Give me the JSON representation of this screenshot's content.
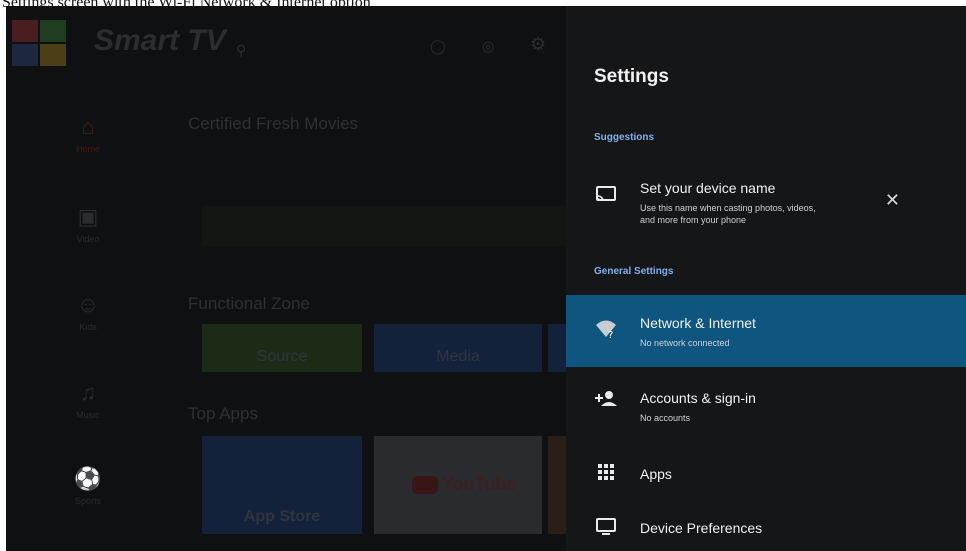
{
  "caption": "Settings screen with the Wi-Fi Network & Internet option",
  "home": {
    "brand": "Smart TV",
    "nav": [
      {
        "icon": "home-icon",
        "label": "Home"
      },
      {
        "icon": "video-icon",
        "label": "Video"
      },
      {
        "icon": "kids-icon",
        "label": "Kids"
      },
      {
        "icon": "music-icon",
        "label": "Music"
      },
      {
        "icon": "sports-icon",
        "label": "Sports"
      }
    ],
    "sections": {
      "certified": "Certified Fresh Movies",
      "functional": "Functional Zone",
      "top_apps": "Top Apps"
    },
    "tiles": {
      "source": "Source",
      "media": "Media",
      "app_store": "App Store",
      "youtube": "YouTube"
    }
  },
  "settings": {
    "title": "Settings",
    "suggestions_header": "Suggestions",
    "general_header": "General Settings",
    "suggestion": {
      "icon": "cast-icon",
      "title": "Set your device name",
      "subtitle_line1": "Use this name when casting photos, videos,",
      "subtitle_line2": "and more from your phone"
    },
    "items": [
      {
        "icon": "wifi-unknown-icon",
        "title": "Network & Internet",
        "subtitle": "No network connected",
        "selected": true
      },
      {
        "icon": "person-add-icon",
        "title": "Accounts & sign-in",
        "subtitle": "No accounts"
      },
      {
        "icon": "apps-grid-icon",
        "title": "Apps",
        "subtitle": ""
      },
      {
        "icon": "tv-icon",
        "title": "Device Preferences",
        "subtitle": ""
      }
    ]
  },
  "colors": {
    "panel": "#151618",
    "selected": "#0e5580",
    "header_accent": "#7fb1ee"
  }
}
